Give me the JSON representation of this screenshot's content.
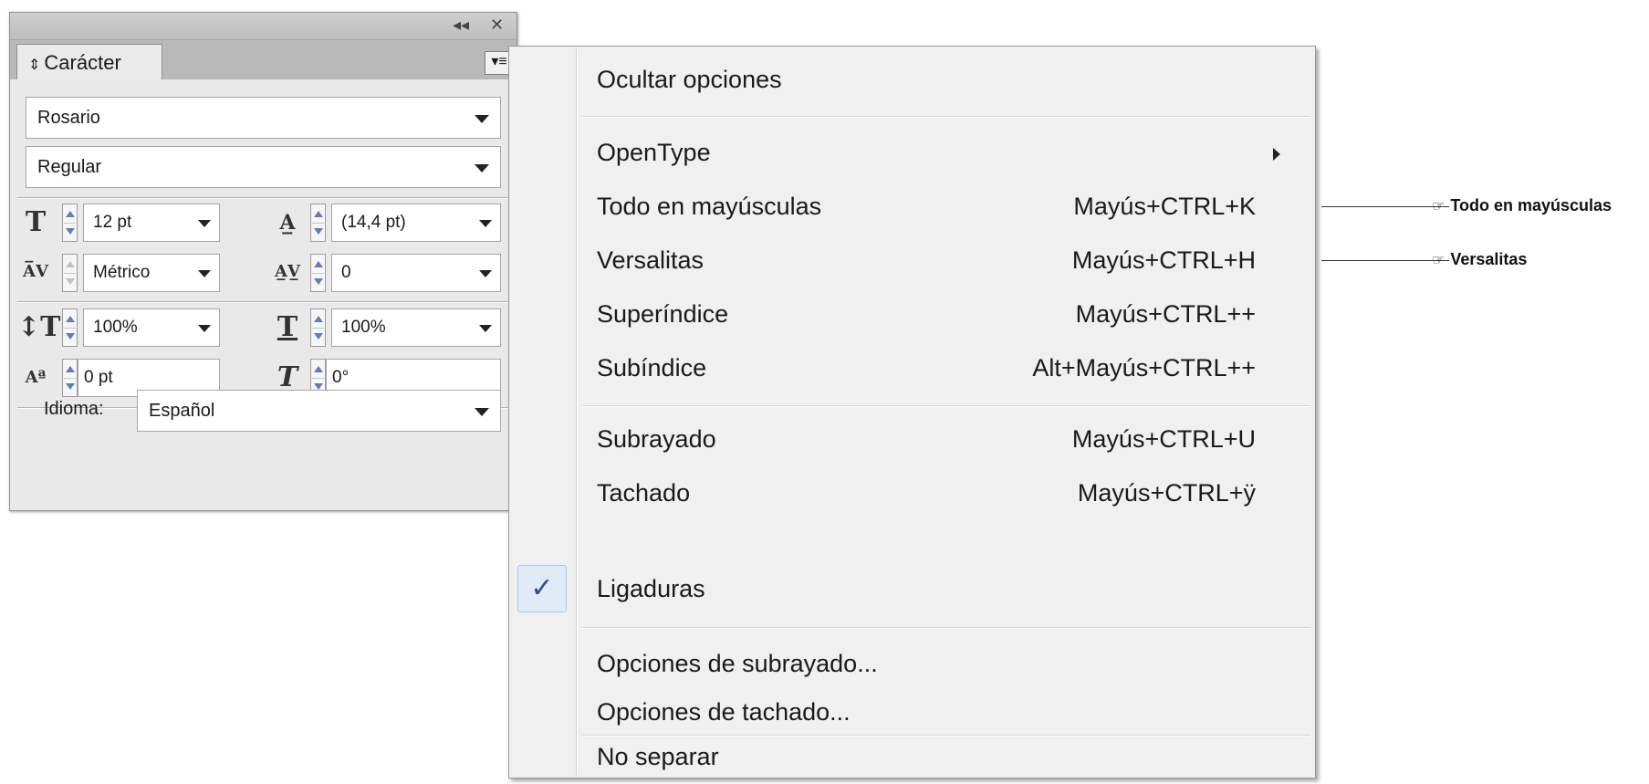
{
  "panel": {
    "tab_label": "Carácter",
    "tab_arrow": "⇕",
    "collapse_icon": "◂◂",
    "close_icon": "✕",
    "menu_icon": "▾≡",
    "font_family": "Rosario",
    "font_style": "Regular",
    "font_size": "12 pt",
    "leading": "(14,4 pt)",
    "kerning": "Métrico",
    "tracking": "0",
    "vertical_scale": "100%",
    "horizontal_scale": "100%",
    "baseline_shift": "0 pt",
    "skew": "0°",
    "language_label": "Idioma:",
    "language": "Español"
  },
  "menu": {
    "items": [
      {
        "label": "Ocultar opciones",
        "shortcut": ""
      },
      {
        "label": "OpenType",
        "shortcut": ""
      },
      {
        "label": "Todo en mayúsculas",
        "shortcut": "Mayús+CTRL+K"
      },
      {
        "label": "Versalitas",
        "shortcut": "Mayús+CTRL+H"
      },
      {
        "label": "Superíndice",
        "shortcut": "Mayús+CTRL++"
      },
      {
        "label": "Subíndice",
        "shortcut": "Alt+Mayús+CTRL++"
      },
      {
        "label": "Subrayado",
        "shortcut": "Mayús+CTRL+U"
      },
      {
        "label": "Tachado",
        "shortcut": "Mayús+CTRL+ÿ"
      },
      {
        "label": "Ligaduras",
        "shortcut": "",
        "checked": true
      },
      {
        "label": "Opciones de subrayado...",
        "shortcut": ""
      },
      {
        "label": "Opciones de tachado...",
        "shortcut": ""
      },
      {
        "label": "No separar",
        "shortcut": ""
      }
    ],
    "check_mark": "✓"
  },
  "callouts": [
    {
      "label": "Todo en mayúsculas",
      "icon": "☞"
    },
    {
      "label": "Versalitas",
      "icon": "☞"
    }
  ],
  "colors": {
    "panel_bg": "#e9e9e9",
    "menu_bg": "#f0f0f0",
    "check_highlight": "#e1ebf7",
    "spinner_arrow": "#5b7fb8"
  }
}
